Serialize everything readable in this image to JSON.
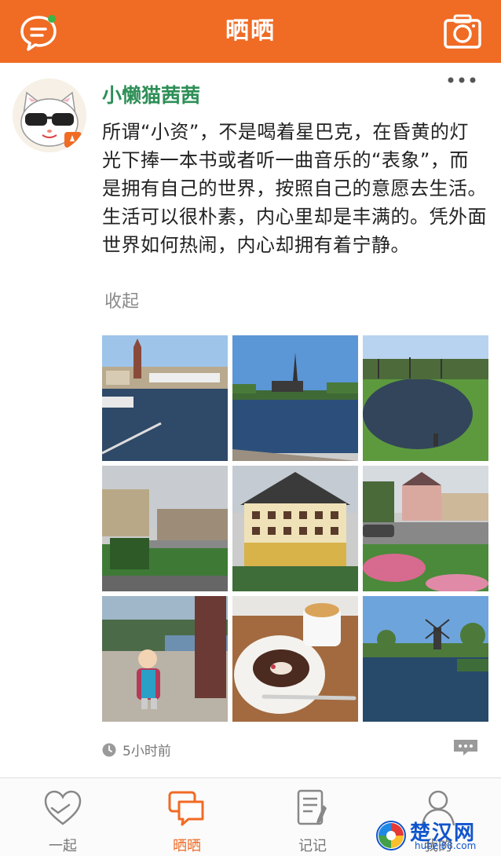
{
  "header": {
    "title": "晒晒",
    "left_icon": "chat-bubble-icon",
    "right_icon": "camera-icon",
    "background_color": "#f06b24"
  },
  "post": {
    "username": "小懒猫茜茜",
    "username_color": "#2e8f57",
    "text": "所谓“小资”，不是喝着星巴克，在昏黄的灯光下捧一本书或者听一曲音乐的“表象”，而是拥有自己的世界，按照自己的意愿去生活。生活可以很朴素，内心里却是丰满的。凭外面世界如何热闹，内心却拥有着宁静。",
    "collapse_label": "收起",
    "time": "5小时前",
    "photos": [
      {
        "subject": "river town with cathedral"
      },
      {
        "subject": "church spire over lake"
      },
      {
        "subject": "park pond with trees"
      },
      {
        "subject": "town street with mountains"
      },
      {
        "subject": "swiss hotel building"
      },
      {
        "subject": "roundabout with flowers"
      },
      {
        "subject": "child by the lake"
      },
      {
        "subject": "cake and coffee"
      },
      {
        "subject": "windmill and canal"
      }
    ]
  },
  "tabbar": {
    "tabs": [
      {
        "label": "一起",
        "icon": "heart-hand-icon"
      },
      {
        "label": "晒晒",
        "icon": "share-bubbles-icon"
      },
      {
        "label": "记记",
        "icon": "note-pad-icon"
      },
      {
        "label": "我的",
        "icon": "profile-icon"
      }
    ],
    "active_index": 1,
    "active_color": "#f06b24"
  },
  "watermark": {
    "text": "楚汉网",
    "url": "hubei88.com"
  }
}
